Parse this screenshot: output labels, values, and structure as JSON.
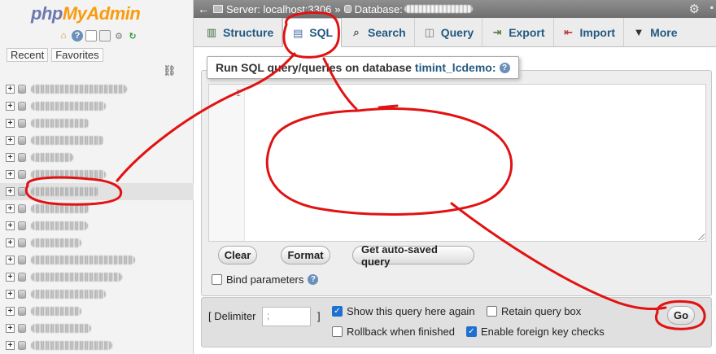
{
  "nav": {
    "logo_php": "php",
    "logo_ma": "MyAdmin",
    "tab_recent": "Recent",
    "tab_favorites": "Favorites",
    "db_count": 16,
    "selected_index": 6
  },
  "topbar": {
    "server": "Server: localhost:3306",
    "sep": "»",
    "database_label": "Database:"
  },
  "tabs": [
    {
      "label": "Structure"
    },
    {
      "label": "SQL"
    },
    {
      "label": "Search"
    },
    {
      "label": "Query"
    },
    {
      "label": "Export"
    },
    {
      "label": "Import"
    },
    {
      "label": "More"
    }
  ],
  "query": {
    "legend_prefix": "Run SQL query/queries on database",
    "db_name": "timint_lcdemo:",
    "line_number": "1",
    "clear": "Clear",
    "format": "Format",
    "autosaved": "Get auto-saved query",
    "bind_params": "Bind parameters"
  },
  "footer": {
    "delimiter_open": "[ Delimiter",
    "delimiter_value": ";",
    "delimiter_close": "]",
    "show_query": "Show this query here again",
    "retain_box": "Retain query box",
    "rollback": "Rollback when finished",
    "foreign_keys": "Enable foreign key checks",
    "go": "Go"
  },
  "colors": {
    "accent": "#235a81",
    "annotation_red": "#e11212",
    "checkbox_on": "#1f6fd1"
  },
  "icons": [
    "home-icon",
    "help-icon",
    "docs-icon",
    "copy-icon",
    "settings-icon",
    "reload-icon",
    "link-icon",
    "gear-icon"
  ]
}
